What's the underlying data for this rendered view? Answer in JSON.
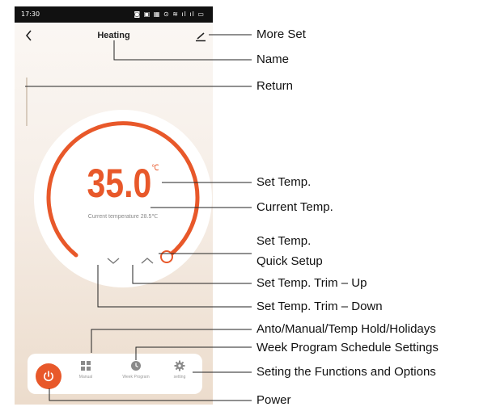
{
  "statusbar": {
    "time": "17:30",
    "icons": "◙ ▣  ▦ ⊙ ≋ ıl ıl ▭"
  },
  "header": {
    "title": "Heating"
  },
  "thermostat": {
    "set_temp": "35.0",
    "unit": "℃",
    "current_temp_text": "Current temperature 28.5℃",
    "accent_color": "#e8582a"
  },
  "bottom_bar": {
    "power_icon": "power-icon",
    "items": [
      {
        "label": "Manual",
        "icon": "grid-icon"
      },
      {
        "label": "Week Program",
        "icon": "clock-icon"
      },
      {
        "label": "setting",
        "icon": "gear-icon"
      }
    ]
  },
  "callouts": {
    "more_set": "More Set",
    "name": "Name",
    "return": "Return",
    "set_temp": "Set Temp.",
    "current_temp": "Current Temp.",
    "quick_setup_line1": "Set Temp.",
    "quick_setup_line2": "Quick Setup",
    "trim_up": "Set Temp. Trim – Up",
    "trim_down": "Set Temp. Trim – Down",
    "mode": "Anto/Manual/Temp Hold/Holidays",
    "week_program": "Week Program Schedule Settings",
    "setting": "Seting the Functions and Options",
    "power": "Power"
  }
}
